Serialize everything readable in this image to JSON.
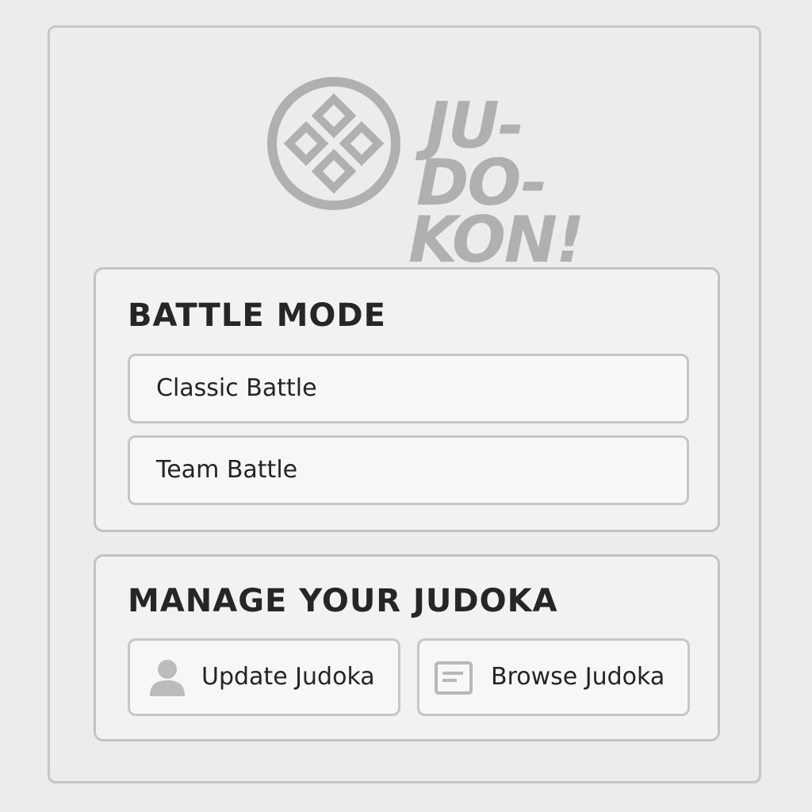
{
  "app": {
    "logo_text_line1": "JU-",
    "logo_text_line2": "DO-",
    "logo_text_line3": "KON!",
    "logo_color": "#b0b0b0"
  },
  "battle_mode": {
    "title": "BATTLE MODE",
    "options": [
      {
        "label": "Classic Battle"
      },
      {
        "label": "Team Battle"
      }
    ]
  },
  "manage": {
    "title": "MANAGE YOUR JUDOKA",
    "buttons": [
      {
        "label": "Update Judoka",
        "icon": "user-icon"
      },
      {
        "label": "Browse Judoka",
        "icon": "card-list-icon"
      }
    ]
  },
  "colors": {
    "background": "#ececec",
    "panel": "#f2f2f2",
    "border": "#c4c4c4",
    "text": "#242424",
    "icon": "#b8b8b8"
  }
}
